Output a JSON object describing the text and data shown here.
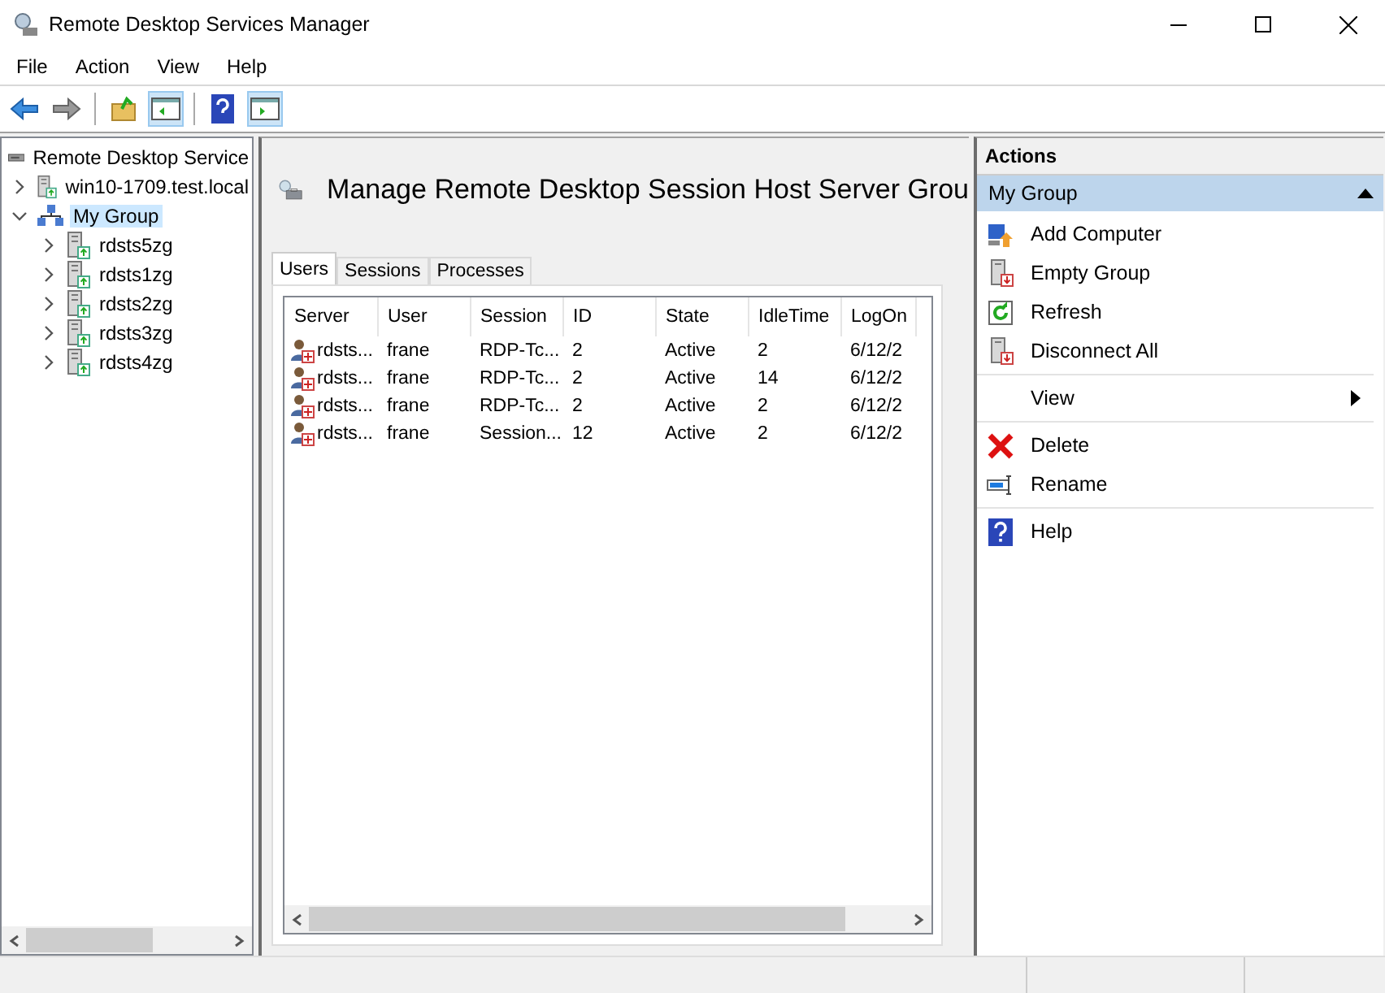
{
  "window": {
    "title": "Remote Desktop Services Manager"
  },
  "menu": [
    "File",
    "Action",
    "View",
    "Help"
  ],
  "tree": {
    "label": "Remote Desktop Service",
    "children": [
      {
        "label": "win10-1709.test.local",
        "kind": "server",
        "expanded": false,
        "selected": false
      },
      {
        "label": "My Group",
        "kind": "group",
        "expanded": true,
        "selected": true,
        "children": [
          {
            "label": "rdsts5zg",
            "kind": "server",
            "expanded": false,
            "selected": false
          },
          {
            "label": "rdsts1zg",
            "kind": "server",
            "expanded": false,
            "selected": false
          },
          {
            "label": "rdsts2zg",
            "kind": "server",
            "expanded": false,
            "selected": false
          },
          {
            "label": "rdsts3zg",
            "kind": "server",
            "expanded": false,
            "selected": false
          },
          {
            "label": "rdsts4zg",
            "kind": "server",
            "expanded": false,
            "selected": false
          }
        ]
      }
    ]
  },
  "content": {
    "heading": "Manage Remote Desktop Session Host Server Grou",
    "tabs": [
      {
        "label": "Users",
        "selected": true
      },
      {
        "label": "Sessions",
        "selected": false
      },
      {
        "label": "Processes",
        "selected": false
      }
    ],
    "table": {
      "columns": [
        "Server",
        "User",
        "Session",
        "ID",
        "State",
        "IdleTime",
        "LogOn"
      ],
      "rows": [
        [
          "rdsts...",
          "frane",
          "RDP-Tc...",
          "2",
          "Active",
          "2",
          "6/12/2"
        ],
        [
          "rdsts...",
          "frane",
          "RDP-Tc...",
          "2",
          "Active",
          "14",
          "6/12/2"
        ],
        [
          "rdsts...",
          "frane",
          "RDP-Tc...",
          "2",
          "Active",
          "2",
          "6/12/2"
        ],
        [
          "rdsts...",
          "frane",
          "Session...",
          "12",
          "Active",
          "2",
          "6/12/2"
        ]
      ]
    }
  },
  "actions": {
    "title": "Actions",
    "section": "My Group",
    "expanded": true,
    "groups": [
      [
        {
          "label": "Add Computer",
          "kind": "add"
        },
        {
          "label": "Empty Group",
          "kind": "server"
        },
        {
          "label": "Refresh",
          "kind": "refresh"
        },
        {
          "label": "Disconnect All",
          "kind": "server"
        }
      ],
      [
        {
          "label": "View",
          "kind": "submenu"
        }
      ],
      [
        {
          "label": "Delete",
          "kind": "delete"
        },
        {
          "label": "Rename",
          "kind": "rename"
        }
      ],
      [
        {
          "label": "Help",
          "kind": "help"
        }
      ]
    ]
  }
}
